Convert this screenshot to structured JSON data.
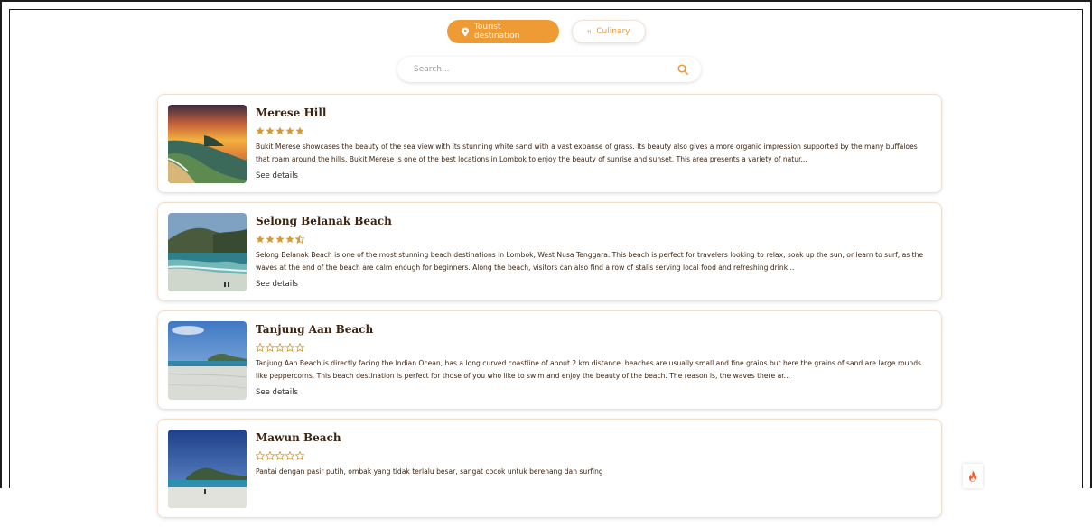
{
  "tabs": [
    {
      "label": "Tourist destination",
      "icon": "location-pin-icon",
      "active": true
    },
    {
      "label": "Culinary",
      "icon": "fork-knife-icon",
      "active": false
    }
  ],
  "search": {
    "placeholder": "Search..."
  },
  "colors": {
    "accent": "#ee9b36",
    "title": "#3b2412",
    "star_filled": "#d59a33"
  },
  "items": [
    {
      "title": "Merese Hill",
      "rating": 5,
      "description": "Bukit Merese showcases the beauty of the sea view with its stunning white sand with a vast expanse of grass. Its beauty also gives a more organic impression supported by the many buffaloes that roam around the hills. Bukit Merese is one of the best locations in Lombok to enjoy the beauty of sunrise and sunset. This area presents a variety of natur...",
      "details_label": "See details"
    },
    {
      "title": "Selong Belanak Beach",
      "rating": 4.5,
      "description": "Selong Belanak Beach is one of the most stunning beach destinations in Lombok, West Nusa Tenggara. This beach is perfect for travelers looking to relax, soak up the sun, or learn to surf, as the waves at the end of the beach are calm enough for beginners. Along the beach, visitors can also find a row of stalls serving local food and refreshing drink...",
      "details_label": "See details"
    },
    {
      "title": "Tanjung Aan Beach",
      "rating": 0,
      "description": "Tanjung Aan Beach is directly facing the Indian Ocean, has a long curved coastline of about 2 km distance. beaches are usually small and fine grains but here the grains of sand are large rounds like peppercorns. This beach destination is perfect for those of you who like to swim and enjoy the beauty of the beach. The reason is, the waves there ar...",
      "details_label": "See details"
    },
    {
      "title": "Mawun Beach",
      "rating": 0,
      "description": "Pantai dengan pasir putih, ombak yang tidak terlalu besar, sangat cocok untuk berenang dan surfing",
      "details_label": ""
    }
  ],
  "floating_button": {
    "icon": "fire-icon"
  }
}
